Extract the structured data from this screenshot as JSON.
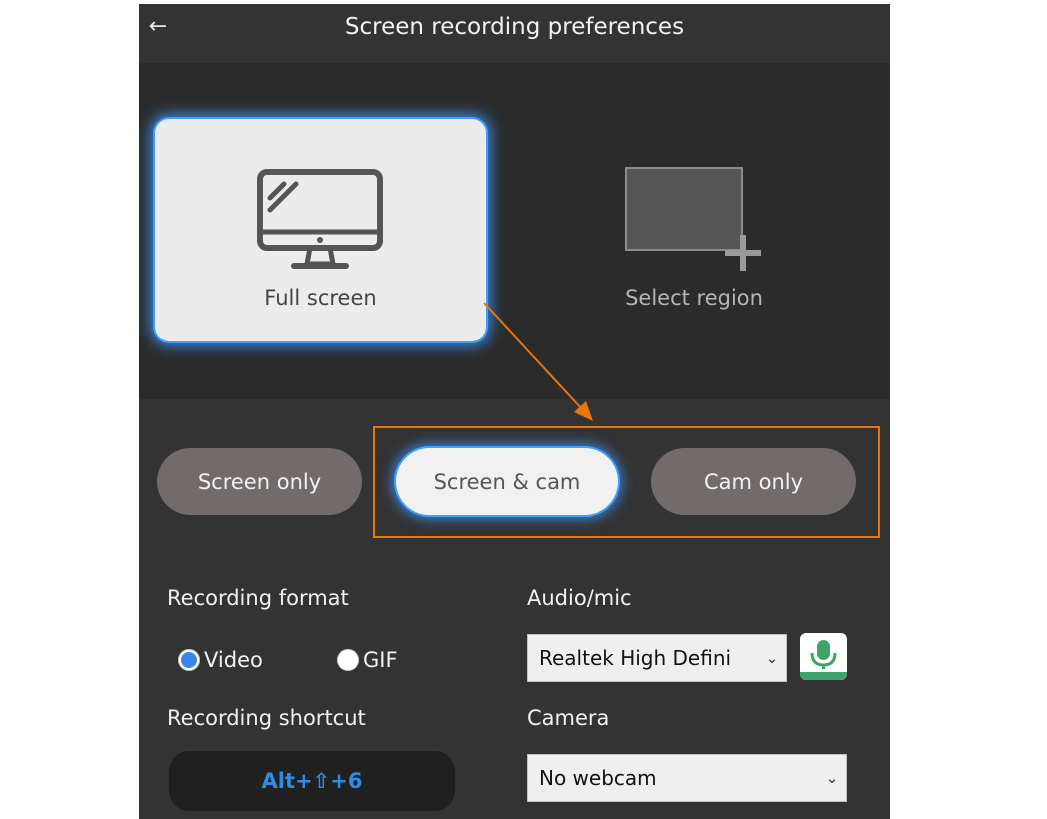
{
  "header": {
    "title": "Screen recording preferences",
    "back_icon": "←"
  },
  "mode": {
    "full_screen_label": "Full screen",
    "select_region_label": "Select region",
    "selected": "Full screen"
  },
  "capture": {
    "options": [
      "Screen only",
      "Screen & cam",
      "Cam only"
    ],
    "selected": "Screen & cam"
  },
  "recording_format": {
    "label": "Recording format",
    "options": [
      "Video",
      "GIF"
    ],
    "selected": "Video"
  },
  "recording_shortcut": {
    "label": "Recording shortcut",
    "value": "Alt+⇧+6"
  },
  "audio": {
    "label": "Audio/mic",
    "value": "Realtek High Defini",
    "chevron": "⌄"
  },
  "camera": {
    "label": "Camera",
    "value": "No webcam",
    "chevron": "⌄"
  },
  "colors": {
    "accent_blue": "#3fa0ff",
    "annotation_orange": "#e8750e",
    "shortcut_text": "#2f8be6",
    "mic_green": "#3fa36a"
  }
}
